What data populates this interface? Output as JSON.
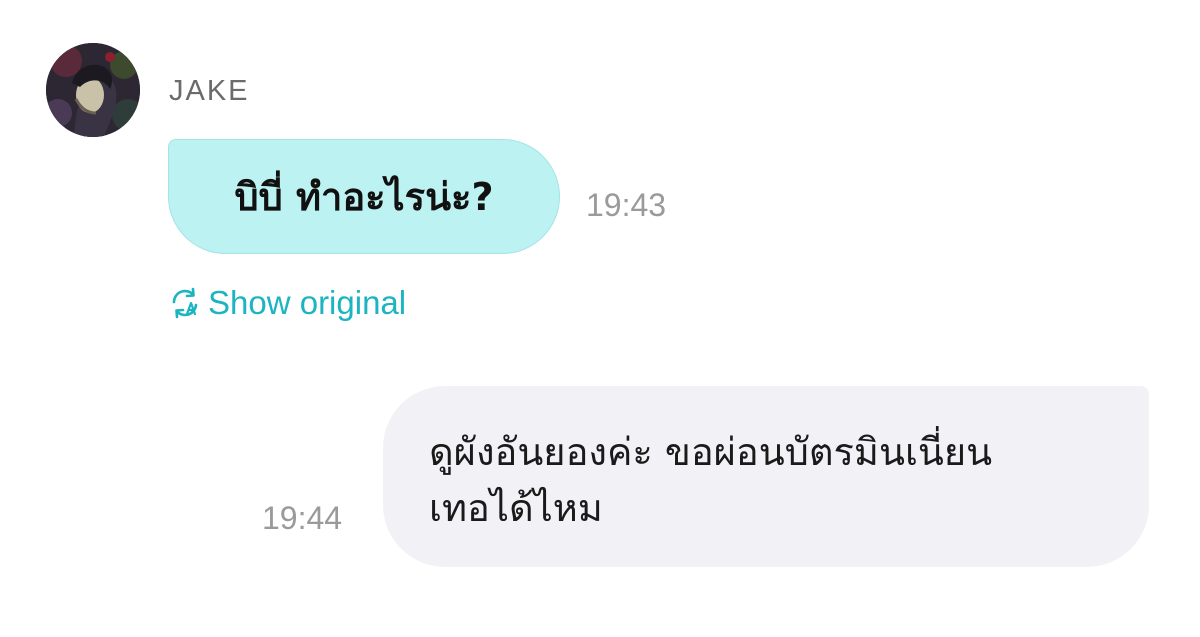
{
  "sender": {
    "name": "JAKE",
    "avatar_icon": "user-avatar-photo"
  },
  "messages": [
    {
      "direction": "incoming",
      "text": "บิบี่ ทำอะไรน่ะ?",
      "time": "19:43",
      "bubble_color": "#bdf2f3"
    },
    {
      "direction": "outgoing",
      "lines": [
        "ดูผังอันยองค่ะ ขอผ่อนบัตรมินเนี่ยน",
        "เทอได้ไหม"
      ],
      "time": "19:44",
      "bubble_color": "#f2f2f6"
    }
  ],
  "translation": {
    "label": "Show original",
    "icon": "translate-icon",
    "color": "#1bb4c0"
  }
}
